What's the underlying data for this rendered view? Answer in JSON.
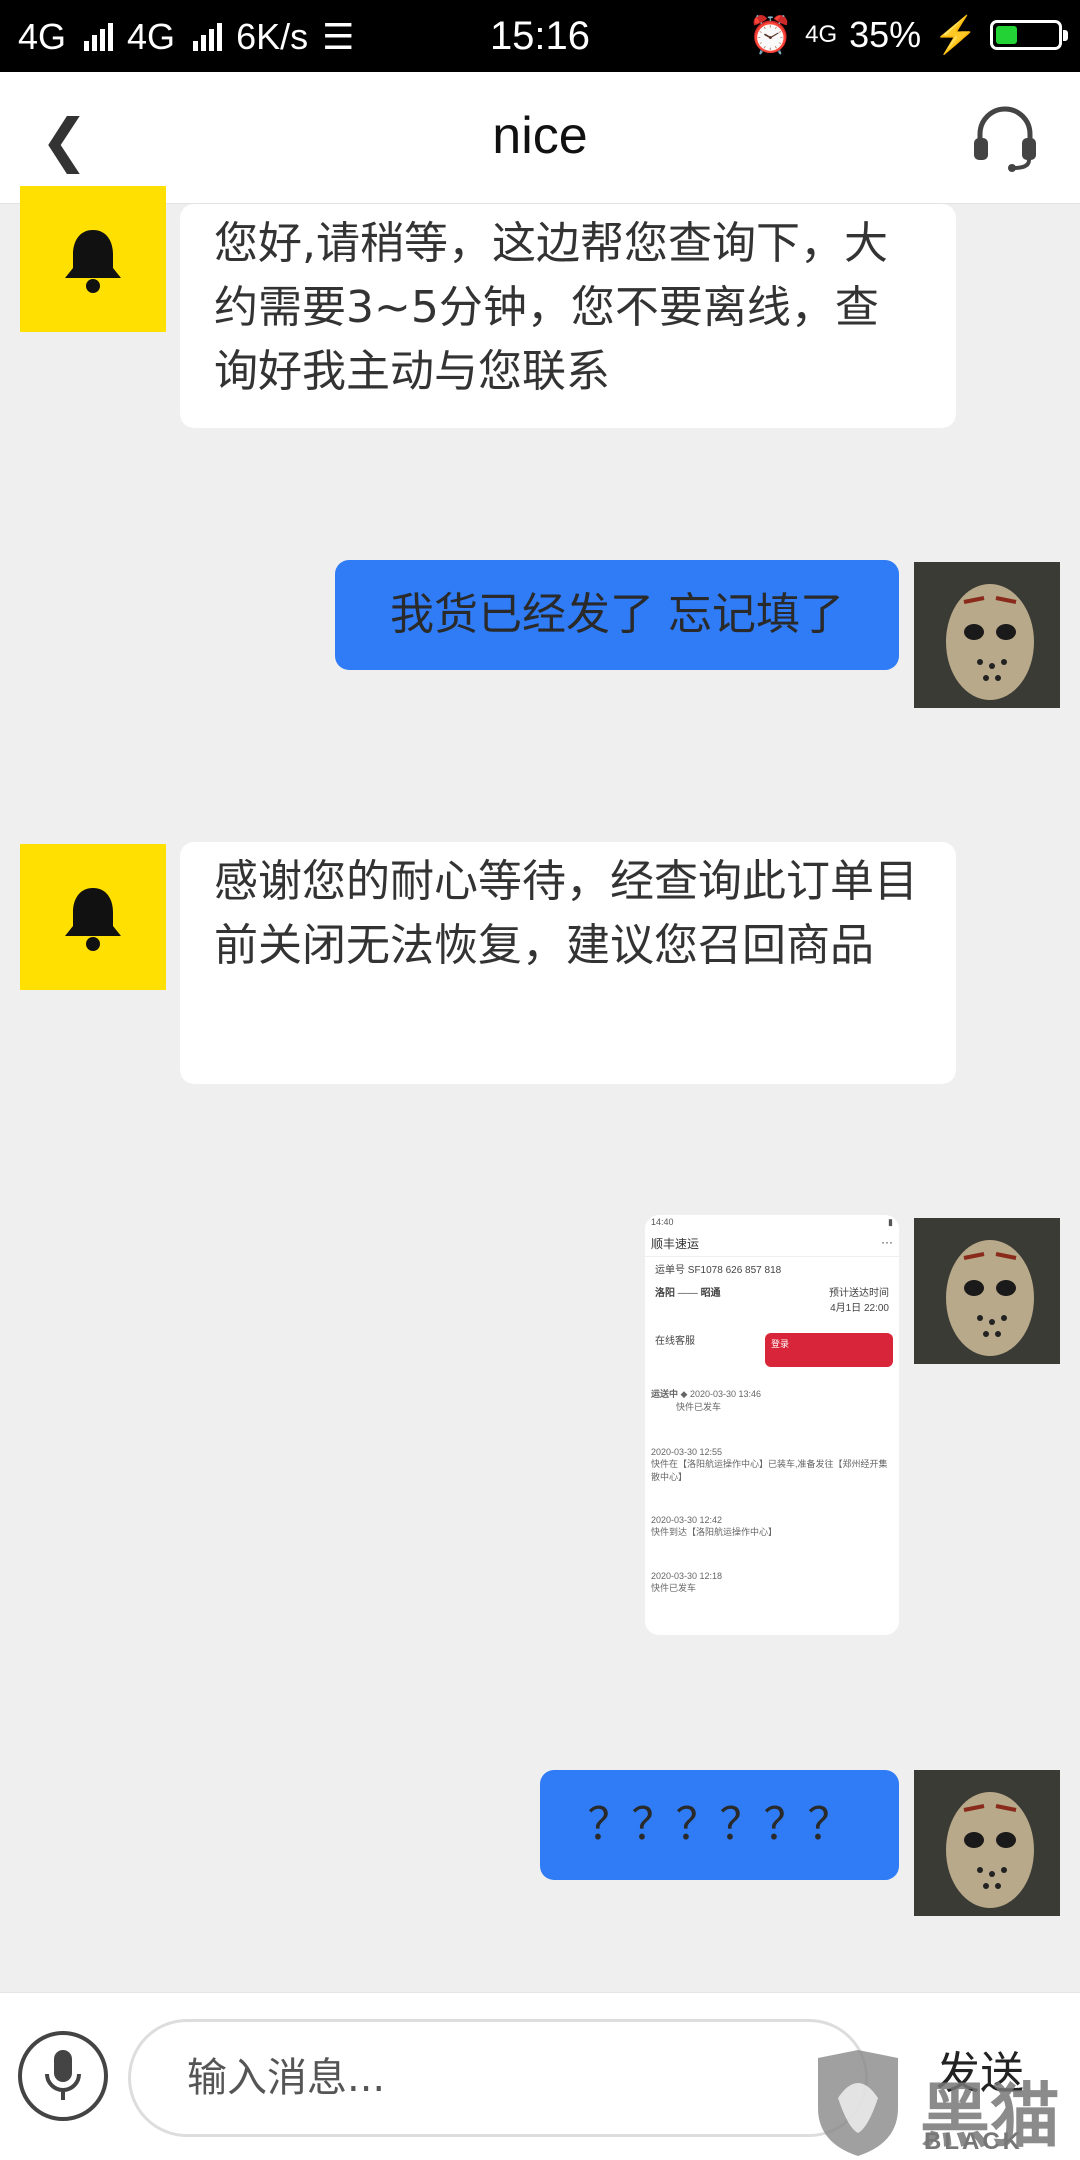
{
  "status_bar": {
    "network1": "4G",
    "network2": "4G",
    "speed": "6K/s",
    "time": "15:16",
    "network3": "4G",
    "battery_percent": "35%",
    "battery_level": 0.35
  },
  "header": {
    "back_icon": "chevron-left-icon",
    "title": "nice",
    "support_icon": "headset-icon"
  },
  "messages": [
    {
      "from": "bot",
      "text": "您好,请稍等，这边帮您查询下，大约需要3~5分钟，您不要离线，查询好我主动与您联系"
    },
    {
      "from": "me",
      "text": "我货已经发了 忘记填了"
    },
    {
      "from": "bot",
      "text": "感谢您的耐心等待，经查询此订单目前关闭无法恢复，建议您召回商品"
    },
    {
      "from": "me",
      "type": "image"
    },
    {
      "from": "me",
      "text": "？？？？？？"
    }
  ],
  "screenshot": {
    "status": "14:40",
    "app_title": "顺丰速运",
    "waybill_label": "运单号",
    "waybill": "SF1078 626 857 818",
    "from": "洛阳",
    "to": "昭通",
    "eta_label": "预计送达时间",
    "eta": "4月1日 22:00",
    "service": "在线客服",
    "login_btn": "登录",
    "current_state": "运送中",
    "events": [
      {
        "time": "2020-03-30 13:46",
        "desc": "快件已发车"
      },
      {
        "time": "2020-03-30 12:55",
        "desc": "快件在【洛阳航运操作中心】已装车,准备发往【郑州经开集散中心】"
      },
      {
        "time": "2020-03-30 12:42",
        "desc": "快件到达【洛阳航运操作中心】"
      },
      {
        "time": "2020-03-30 12:18",
        "desc": "快件已发车"
      }
    ]
  },
  "input_bar": {
    "placeholder": "输入消息...",
    "send_label": "发送",
    "mic_icon": "microphone-icon"
  },
  "watermark": {
    "text": "黑猫",
    "subtext": "BLACK CAT"
  }
}
